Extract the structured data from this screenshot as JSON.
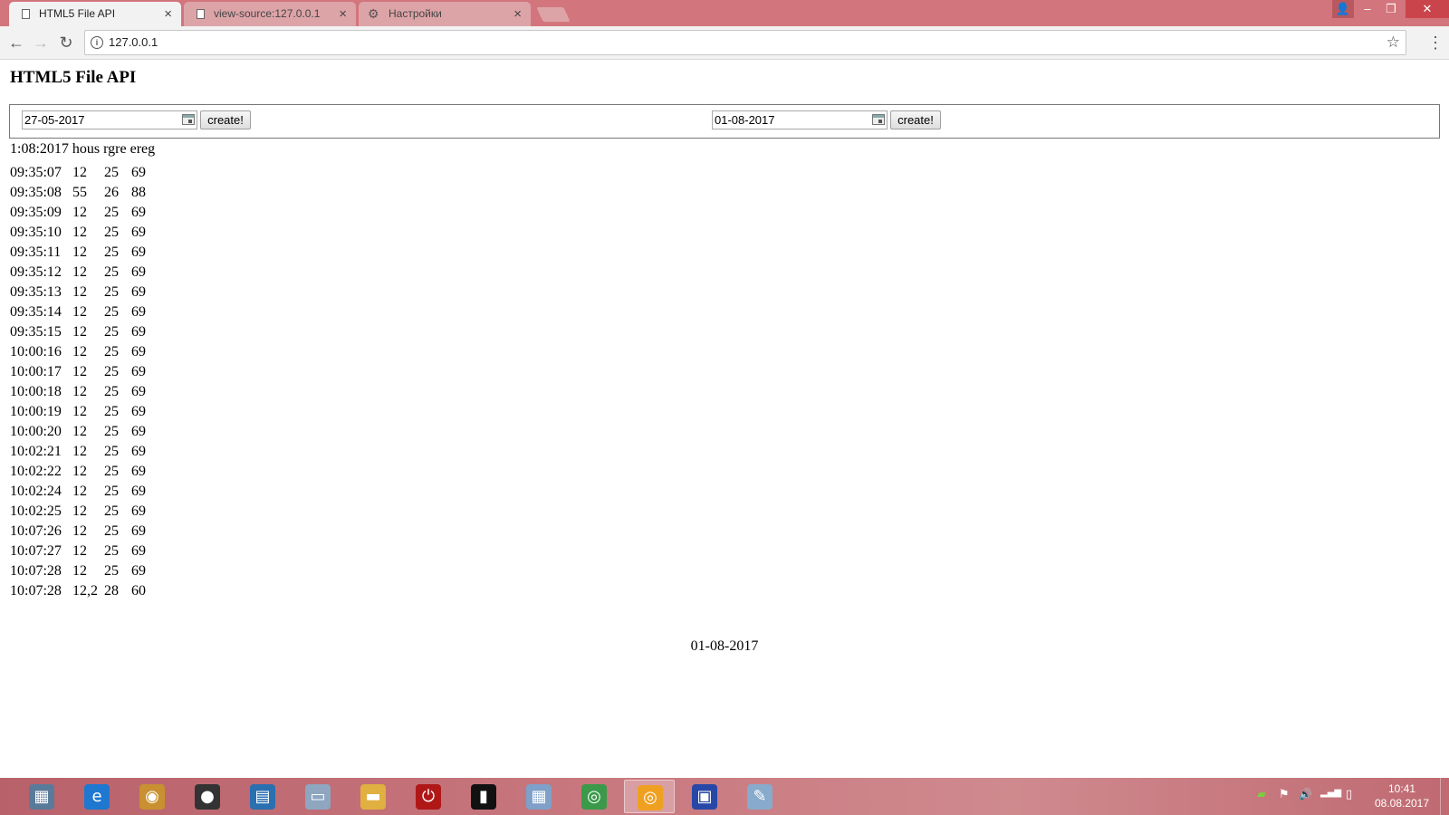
{
  "browser": {
    "tabs": [
      {
        "label": "HTML5 File API",
        "close": "×"
      },
      {
        "label": "view-source:127.0.0.1",
        "close": "×"
      },
      {
        "label": "Настройки",
        "close": "×"
      }
    ],
    "window_controls": {
      "user": "👤",
      "minimize": "–",
      "restore": "❐",
      "close": "✕"
    },
    "nav": {
      "back": "←",
      "forward": "→",
      "reload": "↻",
      "menu": "⋮"
    },
    "omnibox": {
      "info": "i",
      "url": "127.0.0.1",
      "star": "☆"
    }
  },
  "page": {
    "title": "HTML5 File API",
    "form": {
      "left": {
        "date_value": "27-05-2017",
        "button_label": "create!"
      },
      "right": {
        "date_value": "01-08-2017",
        "button_label": "create!"
      }
    },
    "data_header": {
      "date": "1:08:2017",
      "col1": "hous",
      "col2": "rgre",
      "col3": "ereg"
    },
    "rows": [
      {
        "time": "09:35:07",
        "a": "12",
        "b": "25",
        "c": "69"
      },
      {
        "time": "09:35:08",
        "a": "55",
        "b": "26",
        "c": "88"
      },
      {
        "time": "09:35:09",
        "a": "12",
        "b": "25",
        "c": "69"
      },
      {
        "time": "09:35:10",
        "a": "12",
        "b": "25",
        "c": "69"
      },
      {
        "time": "09:35:11",
        "a": "12",
        "b": "25",
        "c": "69"
      },
      {
        "time": "09:35:12",
        "a": "12",
        "b": "25",
        "c": "69"
      },
      {
        "time": "09:35:13",
        "a": "12",
        "b": "25",
        "c": "69"
      },
      {
        "time": "09:35:14",
        "a": "12",
        "b": "25",
        "c": "69"
      },
      {
        "time": "09:35:15",
        "a": "12",
        "b": "25",
        "c": "69"
      },
      {
        "time": "10:00:16",
        "a": "12",
        "b": "25",
        "c": "69"
      },
      {
        "time": "10:00:17",
        "a": "12",
        "b": "25",
        "c": "69"
      },
      {
        "time": "10:00:18",
        "a": "12",
        "b": "25",
        "c": "69"
      },
      {
        "time": "10:00:19",
        "a": "12",
        "b": "25",
        "c": "69"
      },
      {
        "time": "10:00:20",
        "a": "12",
        "b": "25",
        "c": "69"
      },
      {
        "time": "10:02:21",
        "a": "12",
        "b": "25",
        "c": "69"
      },
      {
        "time": "10:02:22",
        "a": "12",
        "b": "25",
        "c": "69"
      },
      {
        "time": "10:02:24",
        "a": "12",
        "b": "25",
        "c": "69"
      },
      {
        "time": "10:02:25",
        "a": "12",
        "b": "25",
        "c": "69"
      },
      {
        "time": "10:07:26",
        "a": "12",
        "b": "25",
        "c": "69"
      },
      {
        "time": "10:07:27",
        "a": "12",
        "b": "25",
        "c": "69"
      },
      {
        "time": "10:07:28",
        "a": "12",
        "b": "25",
        "c": "69"
      },
      {
        "time": "10:07:28",
        "a": "12,2",
        "b": "28",
        "c": "60"
      }
    ],
    "footer_date": "01-08-2017"
  },
  "taskbar": {
    "apps": [
      {
        "name": "doc-manager-icon",
        "glyph": "▦",
        "color": "#5a7a9a",
        "active": false
      },
      {
        "name": "internet-explorer-icon",
        "glyph": "e",
        "color": "#1e78d0",
        "active": false
      },
      {
        "name": "media-app-icon",
        "glyph": "◉",
        "color": "#c89030",
        "active": false
      },
      {
        "name": "speaker-app-icon",
        "glyph": "●",
        "color": "#333333",
        "active": false
      },
      {
        "name": "editor-app-icon",
        "glyph": "▤",
        "color": "#2a6fb0",
        "active": false
      },
      {
        "name": "monitor-app-icon",
        "glyph": "▭",
        "color": "#8ea6c0",
        "active": false
      },
      {
        "name": "folder-icon",
        "glyph": "▬",
        "color": "#e0b040",
        "active": false
      },
      {
        "name": "power-app-icon",
        "glyph": "⏻",
        "color": "#b01818",
        "active": false
      },
      {
        "name": "command-prompt-icon",
        "glyph": "▮",
        "color": "#111111",
        "active": false
      },
      {
        "name": "calculator-icon",
        "glyph": "▦",
        "color": "#7fa0c8",
        "active": false
      },
      {
        "name": "chrome-icon",
        "glyph": "◎",
        "color": "#3a9a4a",
        "active": false
      },
      {
        "name": "chrome-canary-icon",
        "glyph": "◎",
        "color": "#f0a020",
        "active": true
      },
      {
        "name": "save-disk-icon",
        "glyph": "▣",
        "color": "#2848a8",
        "active": false
      },
      {
        "name": "paint-icon",
        "glyph": "✎",
        "color": "#88aacc",
        "active": false
      }
    ],
    "tray": {
      "nvidia": "▰",
      "flag": "⚑",
      "volume": "🔊",
      "signal": "▂▄▆",
      "battery": "▯"
    },
    "clock": {
      "time": "10:41",
      "date": "08.08.2017"
    }
  }
}
